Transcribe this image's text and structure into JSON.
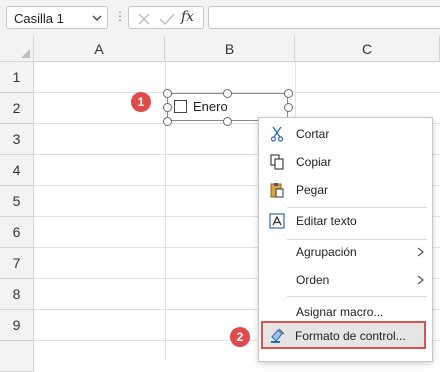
{
  "name_box": {
    "value": "Casilla 1"
  },
  "formula_bar": {
    "fx_label": "fx",
    "dots": "⋮",
    "formula_value": ""
  },
  "columns": [
    "A",
    "B",
    "C"
  ],
  "rows": [
    "1",
    "2",
    "3",
    "4",
    "5",
    "6",
    "7",
    "8",
    "9"
  ],
  "checkbox_control": {
    "label": "Enero",
    "checked": false
  },
  "badges": [
    "1",
    "2"
  ],
  "context_menu": {
    "items": [
      {
        "label": "Cortar",
        "icon": "scissors-icon"
      },
      {
        "label": "Copiar",
        "icon": "copy-icon"
      },
      {
        "label": "Pegar",
        "icon": "paste-icon"
      },
      {
        "label": "Editar texto",
        "icon": "edit-text-icon"
      },
      {
        "label": "Agrupación",
        "submenu": true
      },
      {
        "label": "Orden",
        "submenu": true
      },
      {
        "label": "Asignar macro..."
      },
      {
        "label": "Formato de control...",
        "icon": "format-control-icon",
        "highlighted": true
      }
    ]
  },
  "colors": {
    "badge": "#e04a4a",
    "highlight_border": "#d9534f",
    "icon_blue": "#2b6cb0"
  }
}
